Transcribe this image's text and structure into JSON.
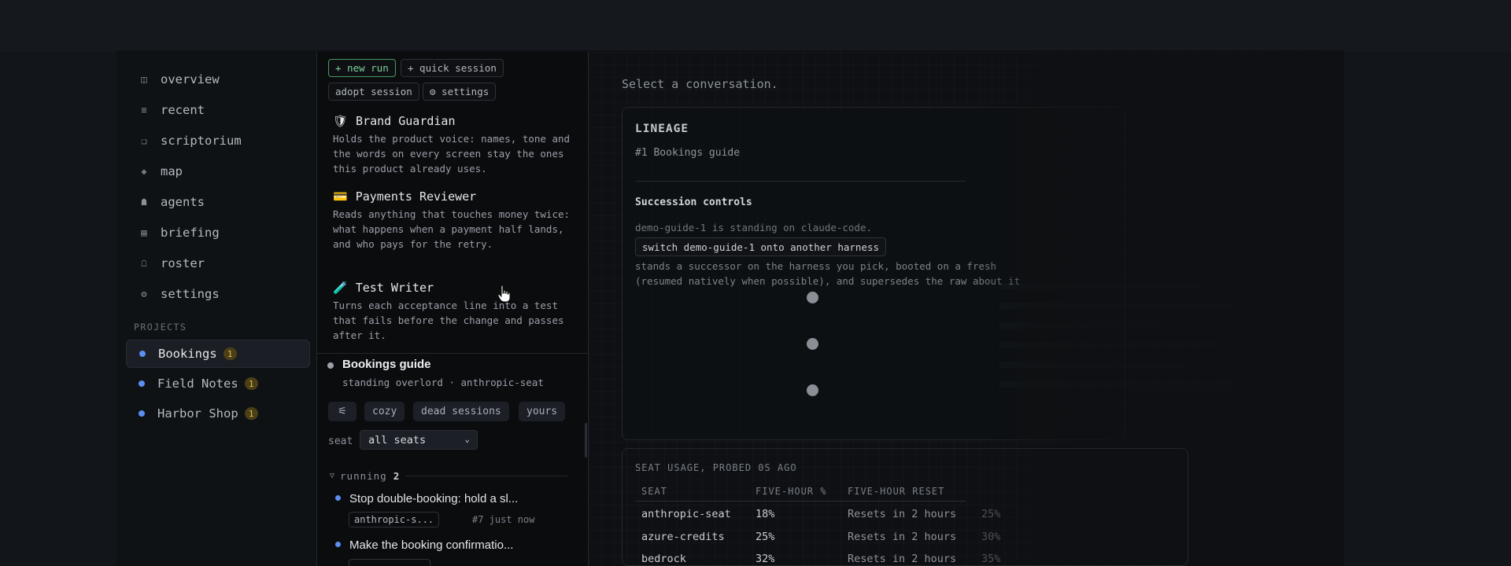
{
  "sidebar": {
    "nav": [
      {
        "icon": "◫",
        "icon_name": "overview-icon",
        "label": "overview"
      },
      {
        "icon": "≡",
        "icon_name": "recent-icon",
        "label": "recent"
      },
      {
        "icon": "❏",
        "icon_name": "scriptorium-icon",
        "label": "scriptorium"
      },
      {
        "icon": "◈",
        "icon_name": "map-icon",
        "label": "map"
      },
      {
        "icon": "☗",
        "icon_name": "agents-icon",
        "label": "agents"
      },
      {
        "icon": "▤",
        "icon_name": "briefing-icon",
        "label": "briefing"
      },
      {
        "icon": "☖",
        "icon_name": "roster-icon",
        "label": "roster"
      },
      {
        "icon": "⚙",
        "icon_name": "settings-icon",
        "label": "settings"
      }
    ],
    "projects_label": "PROJECTS",
    "projects": [
      {
        "name": "Bookings",
        "badge": "1",
        "active": true
      },
      {
        "name": "Field Notes",
        "badge": "1",
        "active": false
      },
      {
        "name": "Harbor Shop",
        "badge": "1",
        "active": false
      }
    ]
  },
  "toolbar": {
    "new_run": "+ new run",
    "quick_session": "+ quick session",
    "adopt_session": "adopt session",
    "settings": "⚙ settings"
  },
  "agents": [
    {
      "emoji": "🛡",
      "name": "Brand Guardian",
      "desc": "Holds the product voice: names, tone and the words on every screen stay the ones this product already uses."
    },
    {
      "emoji": "💳",
      "name": "Payments Reviewer",
      "desc": "Reads anything that touches money twice: what happens when a payment half lands, and who pays for the retry."
    },
    {
      "emoji": "🧪",
      "name": "Test Writer",
      "desc": "Turns each acceptance line into a test that fails before the change and passes after it."
    }
  ],
  "conversation": {
    "title": "Bookings guide",
    "subtitle": "standing overlord · anthropic-seat"
  },
  "filters": {
    "cozy": "cozy",
    "dead_sessions": "dead sessions",
    "yours": "yours",
    "seat_label": "seat",
    "seat_value": "all seats"
  },
  "running": {
    "label": "running",
    "count": "2",
    "items": [
      {
        "title": "Stop double-booking: hold a sl...",
        "seat": "anthropic-s...",
        "meta": "#7 just now"
      },
      {
        "title": "Make the booking confirmatio...",
        "seat": "",
        "meta": ""
      }
    ]
  },
  "detail": {
    "prompt": "Select a conversation.",
    "lineage_title": "LINEAGE",
    "lineage_sub": "#1 Bookings guide",
    "succession_title": "Succession controls",
    "succession_status": "demo-guide-1 is standing on claude-code.",
    "switch_button": "switch demo-guide-1 onto another harness",
    "succession_desc_1": "stands a successor on the harness you pick, booted on a fresh",
    "succession_desc_2": "(resumed natively when possible), and supersedes the raw about it"
  },
  "seat_usage": {
    "heading": "SEAT USAGE, PROBED 0S AGO",
    "columns": [
      "SEAT",
      "FIVE-HOUR %",
      "FIVE-HOUR RESET"
    ],
    "rows": [
      {
        "seat": "anthropic-seat",
        "pct": "18%",
        "reset": "Resets in 2 hours",
        "extra": "25%"
      },
      {
        "seat": "azure-credits",
        "pct": "25%",
        "reset": "Resets in 2 hours",
        "extra": "30%"
      },
      {
        "seat": "bedrock",
        "pct": "32%",
        "reset": "Resets in 2 hours",
        "extra": "35%"
      }
    ]
  }
}
